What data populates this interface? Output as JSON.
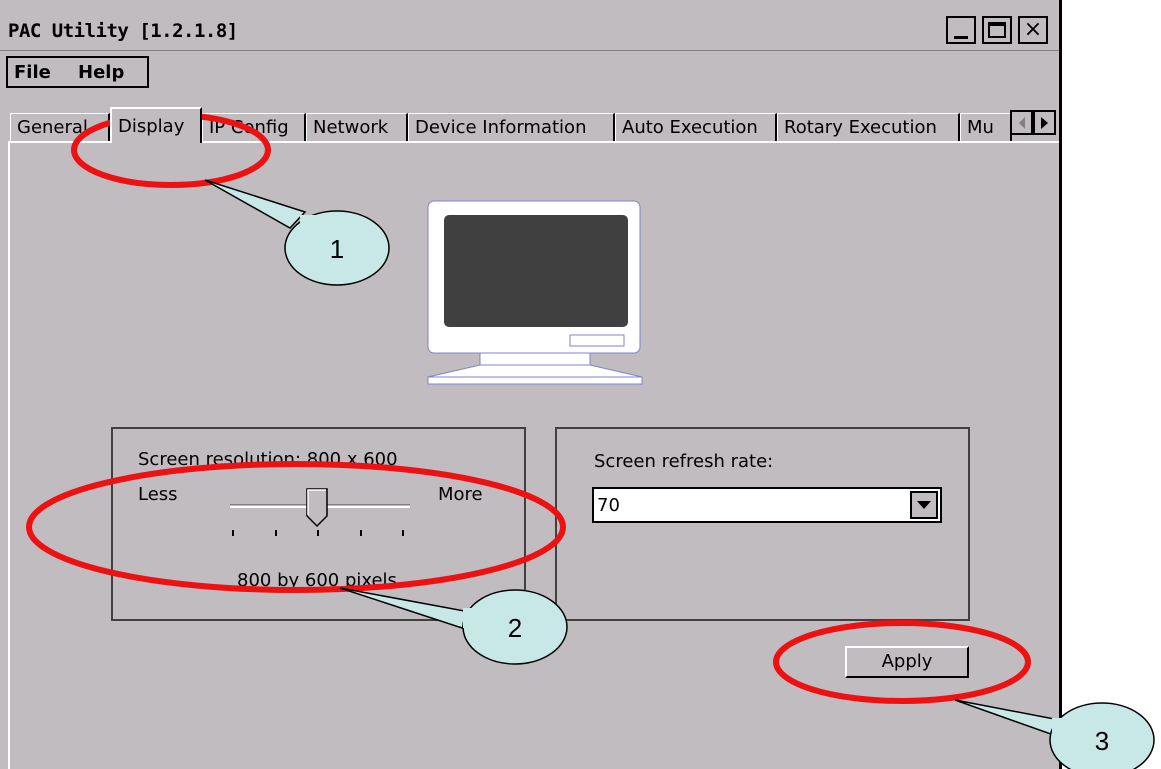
{
  "window": {
    "title": "PAC Utility  [1.2.1.8]"
  },
  "menu": {
    "items": [
      "File",
      "Help"
    ]
  },
  "tabs": [
    {
      "label": "General",
      "active": false
    },
    {
      "label": "Display",
      "active": true
    },
    {
      "label": "IP Config",
      "active": false
    },
    {
      "label": "Network",
      "active": false
    },
    {
      "label": "Device Information",
      "active": false
    },
    {
      "label": "Auto Execution",
      "active": false
    },
    {
      "label": "Rotary Execution",
      "active": false
    },
    {
      "label": "Mu",
      "active": false
    }
  ],
  "display": {
    "resolution_label": "Screen resolution: 800 x 600",
    "less_label": "Less",
    "more_label": "More",
    "pixels_label": "800 by 600 pixels",
    "slider_level": 0.5,
    "refresh_label": "Screen refresh rate:",
    "refresh_value": "70",
    "apply_label": "Apply"
  },
  "callouts": [
    {
      "number": "1"
    },
    {
      "number": "2"
    },
    {
      "number": "3"
    }
  ],
  "colors": {
    "window_bg": "#c0bcc0",
    "annotation_red": "#ee1111",
    "callout_fill": "#c8e8e8",
    "monitor_screen": "#404040"
  }
}
